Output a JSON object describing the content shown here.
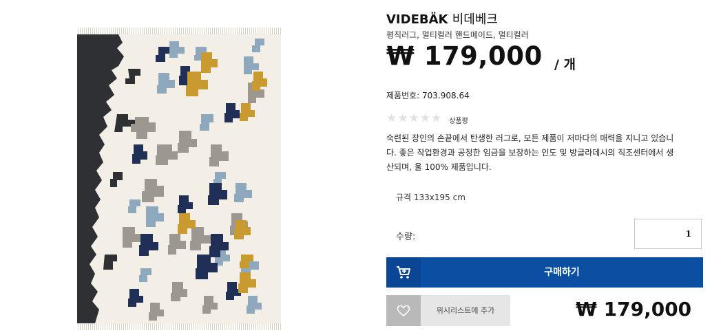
{
  "product": {
    "name": "VIDEBÄK",
    "name_ko": "비데베크",
    "subtitle": "평직러그, 멀티컬러 핸드메이드, 멀티컬러",
    "price": "₩ 179,000",
    "unit": "/ 개",
    "article_number": "제품번호: 703.908.64",
    "rating_stars": "★★★★★",
    "rating_value": 0,
    "rating_label": "상품평",
    "description": "숙련된 장인의 손끝에서 탄생한 러그로, 모든 제품이 저마다의 매력을 지니고 있습니다. 좋은 작업환경과 공정한 임금을 보장하는 인도 및 방글라데시의 직조센터에서 생산되며, 울 100% 제품입니다.",
    "size": "규격 133x195 cm"
  },
  "quantity": {
    "label": "수량:",
    "value": "1"
  },
  "buy": {
    "label": "구매하기",
    "icon": "cart-icon"
  },
  "wishlist": {
    "label": "위시리스트에 추가",
    "icon": "heart-icon"
  },
  "bottom_price": "₩ 179,000",
  "colors": {
    "brand_blue": "#0b4fa3",
    "brand_blue_dark": "#0a4694",
    "rug_charcoal": "#2f3033",
    "rug_cream": "#f3efe6",
    "rug_navy": "#1f2f56",
    "rug_mustard": "#c99a30",
    "rug_lightblue": "#8ea8bd",
    "rug_grey": "#9c978f"
  }
}
